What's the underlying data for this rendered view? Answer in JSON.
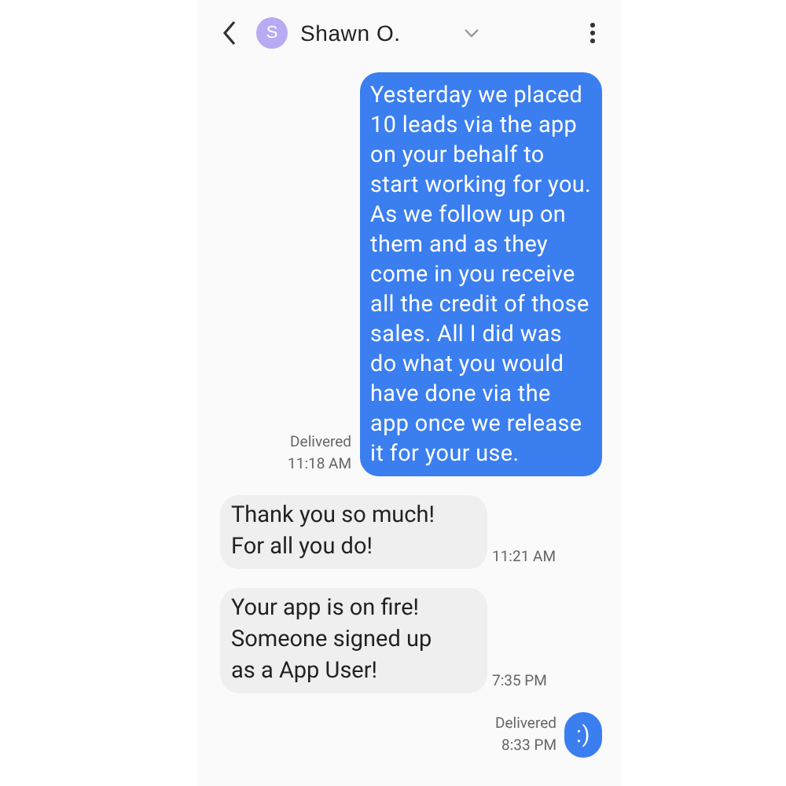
{
  "header": {
    "contact_name": "Shawn O.",
    "avatar_letter": "S"
  },
  "messages": [
    {
      "kind": "sent",
      "text": "Yesterday we placed\n10 leads via the app\non your behalf to\nstart working for you.\nAs we follow up on\nthem and as they\ncome in you receive\nall the credit of those\nsales. All I did was\ndo what you would\nhave done via the\napp once we release\nit for your use.",
      "status": "Delivered",
      "time": "11:18 AM"
    },
    {
      "kind": "received",
      "text": "Thank you so much!\nFor all you do!",
      "time": "11:21 AM"
    },
    {
      "kind": "received",
      "text": "Your app is on fire!\nSomeone signed up\nas a App User!",
      "time": "7:35 PM"
    },
    {
      "kind": "sent",
      "text": ":)",
      "status": "Delivered",
      "time": "8:33 PM"
    }
  ]
}
